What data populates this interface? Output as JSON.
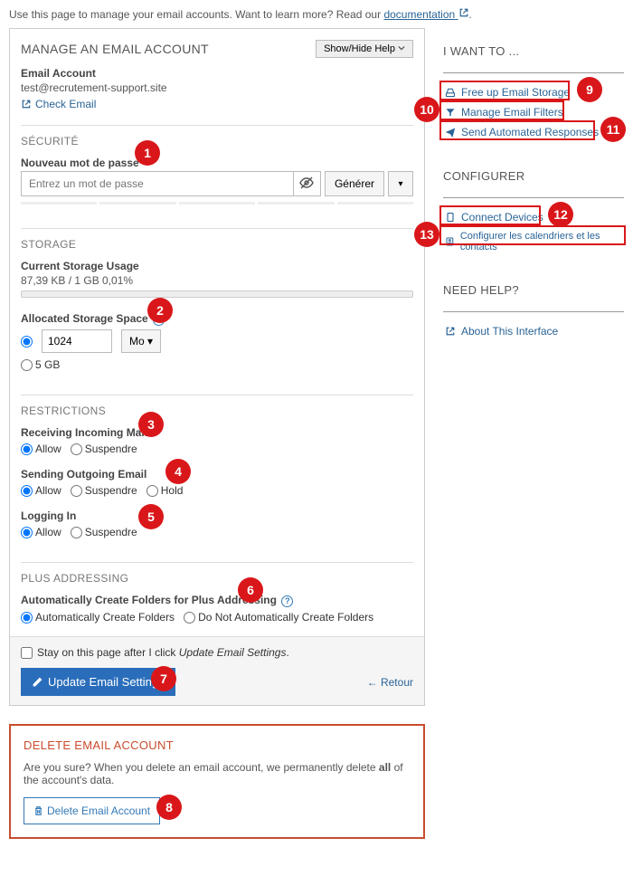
{
  "intro": {
    "text_before": "Use this page to manage your email accounts. Want to learn more? Read our ",
    "doc_link": "documentation",
    "text_after": "."
  },
  "panel": {
    "title": "MANAGE AN EMAIL ACCOUNT",
    "show_hide": "Show/Hide Help",
    "account_label": "Email Account",
    "account_value": "test@recrutement-support.site",
    "check_email": "Check Email"
  },
  "security": {
    "title": "SÉCURITÉ",
    "new_pw_label": "Nouveau mot de passe",
    "placeholder": "Entrez un mot de passe",
    "generate": "Générer"
  },
  "storage": {
    "title": "STORAGE",
    "usage_label": "Current Storage Usage",
    "usage_value": "87,39 KB / 1 GB 0,01%",
    "alloc_label": "Allocated Storage Space",
    "custom_value": "1024",
    "unit": "Mo",
    "fixed_option": "5 GB"
  },
  "restrictions": {
    "title": "RESTRICTIONS",
    "incoming_label": "Receiving Incoming Mail",
    "outgoing_label": "Sending Outgoing Email",
    "login_label": "Logging In",
    "allow": "Allow",
    "suspend": "Suspendre",
    "hold": "Hold"
  },
  "plus": {
    "title": "PLUS ADDRESSING",
    "label": "Automatically Create Folders for Plus Addressing",
    "opt_auto": "Automatically Create Folders",
    "opt_no": "Do Not Automatically Create Folders"
  },
  "footer": {
    "stay_text_before": "Stay on this page after I click ",
    "stay_text_em": "Update Email Settings",
    "update_btn": "Update Email Settings",
    "back": "Retour"
  },
  "delete": {
    "title": "DELETE EMAIL ACCOUNT",
    "msg_before": "Are you sure? When you delete an email account, we permanently delete ",
    "msg_bold": "all",
    "msg_after": " of the account's data.",
    "btn": "Delete Email Account"
  },
  "sidebar": {
    "want": {
      "title": "I WANT TO ...",
      "free_storage": "Free up Email Storage",
      "filters": "Manage Email Filters",
      "auto_resp": "Send Automated Responses"
    },
    "config": {
      "title": "CONFIGURER",
      "devices": "Connect Devices",
      "cal": "Configurer les calendriers et les contacts"
    },
    "help": {
      "title": "NEED HELP?",
      "about": "About This Interface"
    }
  },
  "callouts": {
    "1": "1",
    "2": "2",
    "3": "3",
    "4": "4",
    "5": "5",
    "6": "6",
    "7": "7",
    "8": "8",
    "9": "9",
    "10": "10",
    "11": "11",
    "12": "12",
    "13": "13"
  }
}
